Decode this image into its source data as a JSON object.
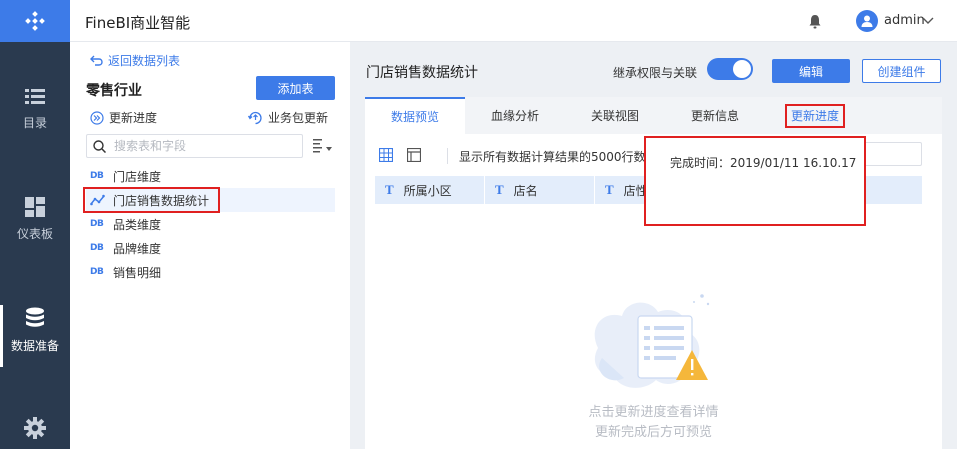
{
  "app": {
    "title": "FineBI商业智能",
    "user": "admin"
  },
  "nav": {
    "items": [
      {
        "label": "目录",
        "icon": "list-icon"
      },
      {
        "label": "仪表板",
        "icon": "dashboard-icon"
      },
      {
        "label": "数据准备",
        "icon": "database-icon",
        "active": true
      },
      {
        "label": "",
        "icon": "gear-icon"
      }
    ]
  },
  "left": {
    "back_label": "返回数据列表",
    "industry": "零售行业",
    "add_table": "添加表",
    "update_progress": "更新进度",
    "package_update": "业务包更新",
    "search_placeholder": "搜索表和字段",
    "tables": [
      {
        "label": "门店维度",
        "type": "DB"
      },
      {
        "label": "门店销售数据统计",
        "type": "analysis",
        "selected": true
      },
      {
        "label": "品类维度",
        "type": "DB"
      },
      {
        "label": "品牌维度",
        "type": "DB"
      },
      {
        "label": "销售明细",
        "type": "DB"
      }
    ]
  },
  "main": {
    "title": "门店销售数据统计",
    "inherit_label": "继承权限与关联",
    "inherit_on": true,
    "edit_label": "编辑",
    "create_label": "创建组件",
    "tabs": [
      {
        "label": "数据预览",
        "active": true
      },
      {
        "label": "血缘分析"
      },
      {
        "label": "关联视图"
      },
      {
        "label": "更新信息"
      },
      {
        "label": "更新进度",
        "highlighted": true
      }
    ],
    "info_text": "显示所有数据计算结果的5000行数",
    "columns": [
      {
        "type": "T",
        "label": "所属小区"
      },
      {
        "type": "T",
        "label": "店名"
      },
      {
        "type": "T",
        "label": "店性"
      }
    ],
    "popup_text": "完成时间：2019/01/11 16.10.17",
    "empty_line1": "点击更新进度查看详情",
    "empty_line2": "更新完成后方可预览"
  },
  "colors": {
    "accent": "#3d7be8",
    "nav_bg": "#2a3a4f",
    "highlight": "#e02020"
  }
}
